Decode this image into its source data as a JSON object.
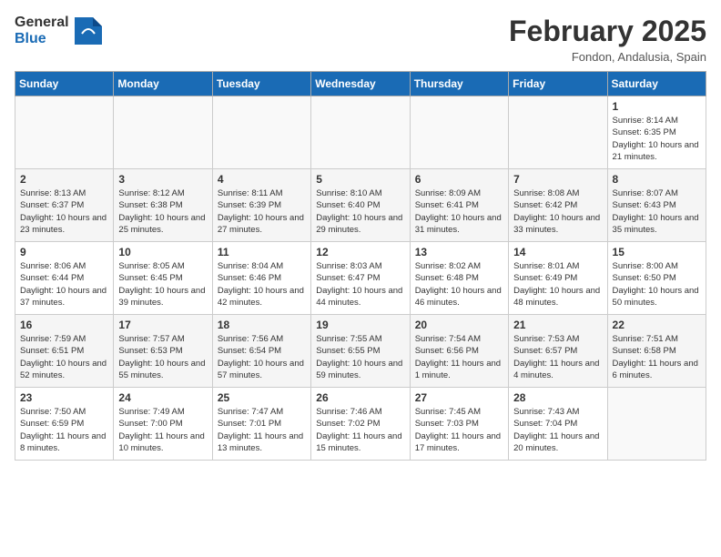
{
  "header": {
    "logo_general": "General",
    "logo_blue": "Blue",
    "title": "February 2025",
    "subtitle": "Fondon, Andalusia, Spain"
  },
  "days_of_week": [
    "Sunday",
    "Monday",
    "Tuesday",
    "Wednesday",
    "Thursday",
    "Friday",
    "Saturday"
  ],
  "weeks": [
    [
      {
        "num": "",
        "info": ""
      },
      {
        "num": "",
        "info": ""
      },
      {
        "num": "",
        "info": ""
      },
      {
        "num": "",
        "info": ""
      },
      {
        "num": "",
        "info": ""
      },
      {
        "num": "",
        "info": ""
      },
      {
        "num": "1",
        "info": "Sunrise: 8:14 AM\nSunset: 6:35 PM\nDaylight: 10 hours and 21 minutes."
      }
    ],
    [
      {
        "num": "2",
        "info": "Sunrise: 8:13 AM\nSunset: 6:37 PM\nDaylight: 10 hours and 23 minutes."
      },
      {
        "num": "3",
        "info": "Sunrise: 8:12 AM\nSunset: 6:38 PM\nDaylight: 10 hours and 25 minutes."
      },
      {
        "num": "4",
        "info": "Sunrise: 8:11 AM\nSunset: 6:39 PM\nDaylight: 10 hours and 27 minutes."
      },
      {
        "num": "5",
        "info": "Sunrise: 8:10 AM\nSunset: 6:40 PM\nDaylight: 10 hours and 29 minutes."
      },
      {
        "num": "6",
        "info": "Sunrise: 8:09 AM\nSunset: 6:41 PM\nDaylight: 10 hours and 31 minutes."
      },
      {
        "num": "7",
        "info": "Sunrise: 8:08 AM\nSunset: 6:42 PM\nDaylight: 10 hours and 33 minutes."
      },
      {
        "num": "8",
        "info": "Sunrise: 8:07 AM\nSunset: 6:43 PM\nDaylight: 10 hours and 35 minutes."
      }
    ],
    [
      {
        "num": "9",
        "info": "Sunrise: 8:06 AM\nSunset: 6:44 PM\nDaylight: 10 hours and 37 minutes."
      },
      {
        "num": "10",
        "info": "Sunrise: 8:05 AM\nSunset: 6:45 PM\nDaylight: 10 hours and 39 minutes."
      },
      {
        "num": "11",
        "info": "Sunrise: 8:04 AM\nSunset: 6:46 PM\nDaylight: 10 hours and 42 minutes."
      },
      {
        "num": "12",
        "info": "Sunrise: 8:03 AM\nSunset: 6:47 PM\nDaylight: 10 hours and 44 minutes."
      },
      {
        "num": "13",
        "info": "Sunrise: 8:02 AM\nSunset: 6:48 PM\nDaylight: 10 hours and 46 minutes."
      },
      {
        "num": "14",
        "info": "Sunrise: 8:01 AM\nSunset: 6:49 PM\nDaylight: 10 hours and 48 minutes."
      },
      {
        "num": "15",
        "info": "Sunrise: 8:00 AM\nSunset: 6:50 PM\nDaylight: 10 hours and 50 minutes."
      }
    ],
    [
      {
        "num": "16",
        "info": "Sunrise: 7:59 AM\nSunset: 6:51 PM\nDaylight: 10 hours and 52 minutes."
      },
      {
        "num": "17",
        "info": "Sunrise: 7:57 AM\nSunset: 6:53 PM\nDaylight: 10 hours and 55 minutes."
      },
      {
        "num": "18",
        "info": "Sunrise: 7:56 AM\nSunset: 6:54 PM\nDaylight: 10 hours and 57 minutes."
      },
      {
        "num": "19",
        "info": "Sunrise: 7:55 AM\nSunset: 6:55 PM\nDaylight: 10 hours and 59 minutes."
      },
      {
        "num": "20",
        "info": "Sunrise: 7:54 AM\nSunset: 6:56 PM\nDaylight: 11 hours and 1 minute."
      },
      {
        "num": "21",
        "info": "Sunrise: 7:53 AM\nSunset: 6:57 PM\nDaylight: 11 hours and 4 minutes."
      },
      {
        "num": "22",
        "info": "Sunrise: 7:51 AM\nSunset: 6:58 PM\nDaylight: 11 hours and 6 minutes."
      }
    ],
    [
      {
        "num": "23",
        "info": "Sunrise: 7:50 AM\nSunset: 6:59 PM\nDaylight: 11 hours and 8 minutes."
      },
      {
        "num": "24",
        "info": "Sunrise: 7:49 AM\nSunset: 7:00 PM\nDaylight: 11 hours and 10 minutes."
      },
      {
        "num": "25",
        "info": "Sunrise: 7:47 AM\nSunset: 7:01 PM\nDaylight: 11 hours and 13 minutes."
      },
      {
        "num": "26",
        "info": "Sunrise: 7:46 AM\nSunset: 7:02 PM\nDaylight: 11 hours and 15 minutes."
      },
      {
        "num": "27",
        "info": "Sunrise: 7:45 AM\nSunset: 7:03 PM\nDaylight: 11 hours and 17 minutes."
      },
      {
        "num": "28",
        "info": "Sunrise: 7:43 AM\nSunset: 7:04 PM\nDaylight: 11 hours and 20 minutes."
      },
      {
        "num": "",
        "info": ""
      }
    ]
  ]
}
